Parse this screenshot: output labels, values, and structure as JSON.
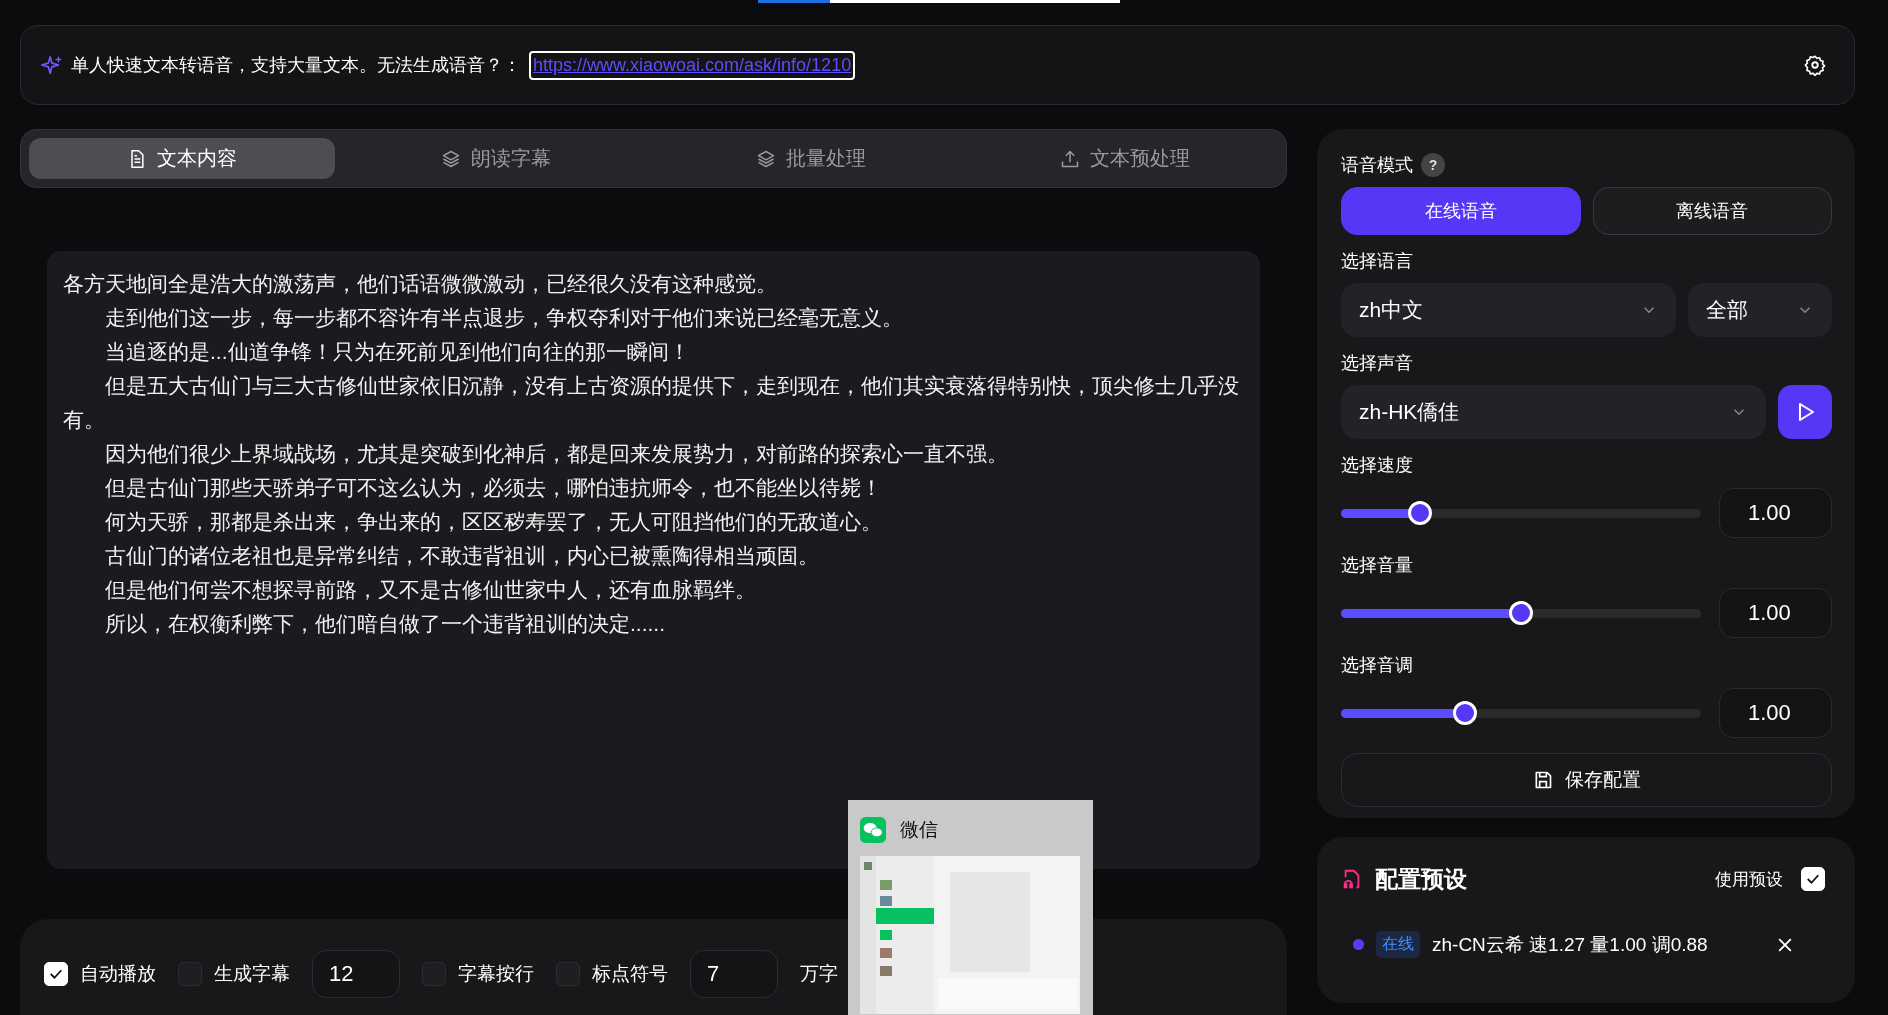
{
  "top_progress": {
    "level": 0.2
  },
  "banner": {
    "text": "单人快速文本转语音，支持大量文本。无法生成语音？：",
    "link": "https://www.xiaowoai.com/ask/info/1210"
  },
  "tabs": [
    {
      "label": "文本内容",
      "selected": true
    },
    {
      "label": "朗读字幕",
      "selected": false
    },
    {
      "label": "批量处理",
      "selected": false
    },
    {
      "label": "文本预处理",
      "selected": false
    }
  ],
  "text_content": [
    "各方天地间全是浩大的激荡声，他们话语微微激动，已经很久没有这种感觉。",
    "　　走到他们这一步，每一步都不容许有半点退步，争权夺利对于他们来说已经毫无意义。",
    "　　当追逐的是...仙道争锋！只为在死前见到他们向往的那一瞬间！",
    "　　但是五大古仙门与三大古修仙世家依旧沉静，没有上古资源的提供下，走到现在，他们其实衰落得特别快，顶尖修士几乎没有。",
    "　　因为他们很少上界域战场，尤其是突破到化神后，都是回来发展势力，对前路的探索心一直不强。",
    "　　但是古仙门那些天骄弟子可不这么认为，必须去，哪怕违抗师令，也不能坐以待毙！",
    "　　何为天骄，那都是杀出来，争出来的，区区秽寿罢了，无人可阻挡他们的无敌道心。",
    "　　古仙门的诸位老祖也是异常纠结，不敢违背祖训，内心已被熏陶得相当顽固。",
    "　　但是他们何尝不想探寻前路，又不是古修仙世家中人，还有血脉羁绊。",
    "　　所以，在权衡利弊下，他们暗自做了一个违背祖训的决定......"
  ],
  "bottom_bar": [
    {
      "kind": "checkbox",
      "label": "自动播放",
      "checked": true
    },
    {
      "kind": "checkbox",
      "label": "生成字幕",
      "checked": false
    },
    {
      "kind": "input",
      "value": "12"
    },
    {
      "kind": "checkbox",
      "label": "字幕按行",
      "checked": false
    },
    {
      "kind": "checkbox",
      "label": "标点符号",
      "checked": false
    },
    {
      "kind": "input",
      "value": "7"
    },
    {
      "kind": "text",
      "label": "万字"
    }
  ],
  "settings": {
    "mode_label": "语音模式",
    "help": "?",
    "modes": [
      {
        "label": "在线语音",
        "selected": true
      },
      {
        "label": "离线语音",
        "selected": false
      }
    ],
    "language_label": "选择语言",
    "language": "zh中文",
    "region": "全部",
    "voice_label": "选择声音",
    "voice": "zh-HK僑佳",
    "sliders": [
      {
        "label": "选择速度",
        "level": 0.22,
        "reading": "1.00"
      },
      {
        "label": "选择音量",
        "level": 0.5,
        "reading": "1.00"
      },
      {
        "label": "选择音调",
        "level": 0.345,
        "reading": "1.00"
      }
    ],
    "save": "保存配置"
  },
  "presets": {
    "title": "配置预设",
    "use_label": "使用预设",
    "use_checked": true,
    "items": [
      {
        "tag": "在线",
        "text": "zh-CN云希 速1.27 量1.00 调0.88",
        "color": "#5b3cf5"
      }
    ]
  },
  "taskbar_preview": {
    "title": "微信"
  }
}
